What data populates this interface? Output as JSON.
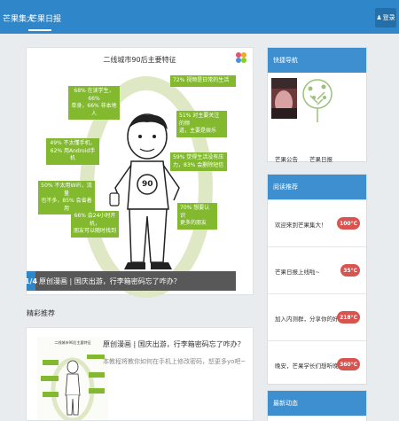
{
  "header": {
    "brand": "芒果集大",
    "tab": "芒果日报",
    "login_label": "登录"
  },
  "feature": {
    "infographic_title": "二线城市90后主要特征",
    "callouts_left": [
      "68% 在读学生，66%\n单身，66% 非本地人",
      "49% 不太懂手机，\n62% 用Android手机",
      "50% 不太用WiFi，流量\n也不多，85% 会省着用",
      "66% 会24小时开机，\n朋友可以随时找到"
    ],
    "callouts_right": [
      "72% 视频是日常的生活",
      "51% 对主要关注的频\n道，主要是娱乐",
      "59% 觉得生活没有压\n力，83% 会删除短信",
      "70% 想要认识\n更多的朋友"
    ],
    "shirt_number": "90",
    "caption_index": "1/4",
    "caption": "原创漫画 | 国庆出游，行李箱密码忘了咋办？"
  },
  "recommend": {
    "label": "精彩推荐",
    "thumb_title": "二线城市90后主要特征",
    "title": "原创漫画 | 国庆出游，行李箱密码忘了咋办？",
    "subtitle": "本教程将教你如何在手机上修改密码，恕更多yo吧~"
  },
  "sidebar": {
    "quick_nav": {
      "title": "快捷导航",
      "items": [
        "芒果公告",
        "芒果日报"
      ]
    },
    "reading": {
      "title": "阅读推荐",
      "items": [
        {
          "text": "欢迎来到芒果集大！",
          "heat": "100°C"
        },
        {
          "text": "芒果日报上线啦~",
          "heat": "35°C"
        },
        {
          "text": "加入内测群，分享你的好idea。",
          "heat": "218°C"
        },
        {
          "text": "晚安，芒果学长们想听晚安~",
          "heat": "360°C"
        }
      ]
    },
    "latest": {
      "title": "最新动态"
    }
  },
  "colors": {
    "header_blue": "#2f86c8",
    "callout_green": "#82b92f",
    "heat_red": "#d9534f"
  }
}
